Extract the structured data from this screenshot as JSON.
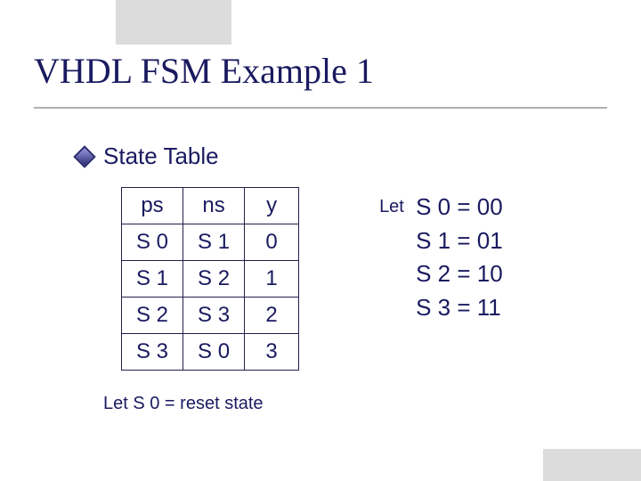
{
  "title": "VHDL FSM Example 1",
  "bullet_label": "State Table",
  "chart_data": {
    "type": "table",
    "columns": [
      "ps",
      "ns",
      "y"
    ],
    "rows": [
      {
        "ps": "S 0",
        "ns": "S 1",
        "y": "0"
      },
      {
        "ps": "S 1",
        "ns": "S 2",
        "y": "1"
      },
      {
        "ps": "S 2",
        "ns": "S 3",
        "y": "2"
      },
      {
        "ps": "S 3",
        "ns": "S 0",
        "y": "3"
      }
    ]
  },
  "encodings": {
    "let_label": "Let",
    "lines": [
      "S 0 = 00",
      "S 1 = 01",
      "S 2 = 10",
      "S 3 = 11"
    ]
  },
  "reset_note": "Let S 0 = reset state"
}
